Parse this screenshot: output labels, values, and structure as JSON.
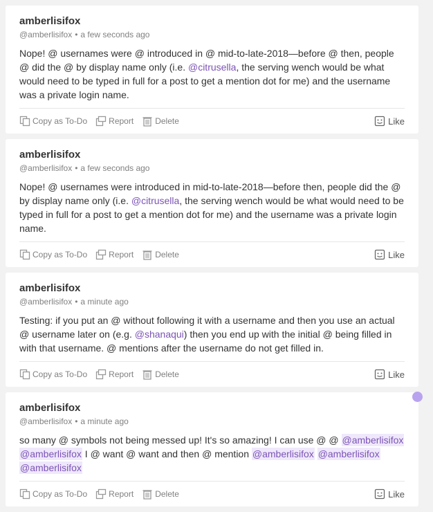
{
  "posts": [
    {
      "username": "amberlisifox",
      "handle": "@amberlisifox",
      "separator": "•",
      "time": "a few seconds ago",
      "body": [
        {
          "t": "Nope! @ usernames were @ introduced in @ mid-to-late-2018—before @ then, people @ did the @ by display name only (i.e. "
        },
        {
          "m": "@citrusella"
        },
        {
          "t": ", the serving wench would be what would need to be typed in full for a post to get a mention dot for me) and the username was a private login name."
        }
      ],
      "actions": {
        "copy": "Copy as To-Do",
        "report": "Report",
        "delete": "Delete",
        "like": "Like"
      }
    },
    {
      "username": "amberlisifox",
      "handle": "@amberlisifox",
      "separator": "•",
      "time": "a few seconds ago",
      "body": [
        {
          "t": "Nope! @ usernames were introduced in mid-to-late-2018—before then, people did the @ by display name only (i.e. "
        },
        {
          "m": "@citrusella"
        },
        {
          "t": ", the serving wench would be what would need to be typed in full for a post to get a mention dot for me) and the username was a private login name."
        }
      ],
      "actions": {
        "copy": "Copy as To-Do",
        "report": "Report",
        "delete": "Delete",
        "like": "Like"
      }
    },
    {
      "username": "amberlisifox",
      "handle": "@amberlisifox",
      "separator": "•",
      "time": "a minute ago",
      "body": [
        {
          "t": "Testing: if you put an @ without following it with a username and then you use an actual @ username later on (e.g. "
        },
        {
          "m": "@shanaqui"
        },
        {
          "t": ") then you end up with the initial @ being filled in with that username. @ mentions after the username do not get filled in."
        }
      ],
      "actions": {
        "copy": "Copy as To-Do",
        "report": "Report",
        "delete": "Delete",
        "like": "Like"
      }
    },
    {
      "username": "amberlisifox",
      "handle": "@amberlisifox",
      "separator": "•",
      "time": "a minute ago",
      "body": [
        {
          "t": "so many @ symbols not being messed up! It's so amazing! I can use @ @ "
        },
        {
          "ms": "@amberlisifox"
        },
        {
          "t": " "
        },
        {
          "ms": "@amberlisifox"
        },
        {
          "t": " I @ want @ want and then @ mention "
        },
        {
          "ms": "@amberlisifox"
        },
        {
          "t": " "
        },
        {
          "ms": "@amberlisifox"
        },
        {
          "t": " "
        },
        {
          "ms": "@amberlisifox"
        }
      ],
      "actions": {
        "copy": "Copy as To-Do",
        "report": "Report",
        "delete": "Delete",
        "like": "Like"
      }
    }
  ],
  "colors": {
    "mention": "#7b53b5",
    "mention_self_bg": "#efe8fb",
    "scroll_indicator": "#b9a3ef"
  },
  "icons": {
    "copy": "copy-icon",
    "report": "report-flag-icon",
    "delete": "trash-icon",
    "like": "smiley-icon"
  }
}
